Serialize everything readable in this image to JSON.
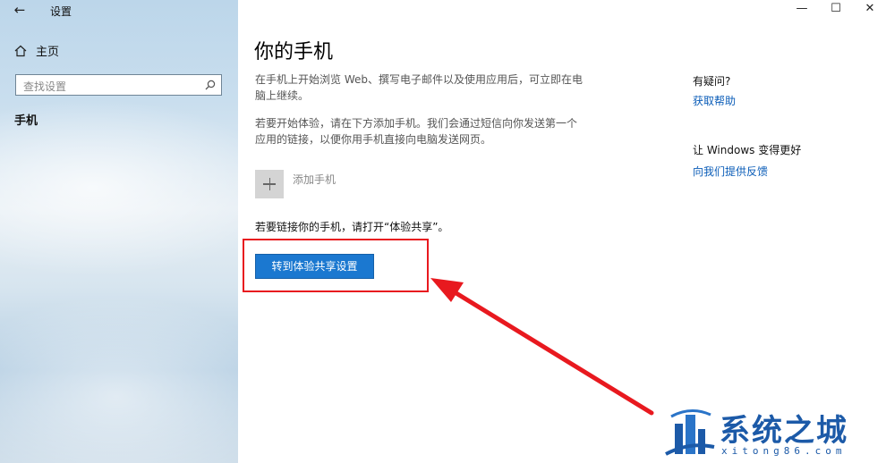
{
  "window": {
    "title": "设置",
    "back_glyph": "←",
    "minimize_glyph": "—",
    "maximize_glyph": "☐",
    "close_glyph": "✕"
  },
  "sidebar": {
    "home_label": "主页",
    "search_placeholder": "查找设置",
    "items": [
      {
        "label": "手机",
        "selected": true
      }
    ]
  },
  "main": {
    "title": "你的手机",
    "intro": "在手机上开始浏览 Web、撰写电子邮件以及使用应用后，可立即在电脑上继续。",
    "instruction": "若要开始体验，请在下方添加手机。我们会通过短信向你发送第一个应用的链接，以便你用手机直接向电脑发送网页。",
    "add_phone_label": "添加手机",
    "link_note": "若要链接你的手机，请打开“体验共享”。",
    "primary_button_label": "转到体验共享设置"
  },
  "help": {
    "question_heading": "有疑问?",
    "help_link": "获取帮助",
    "improve_heading": "让 Windows 变得更好",
    "feedback_link": "向我们提供反馈"
  },
  "watermark": {
    "brand": "系统之城",
    "domain": "xitong86.com"
  },
  "colors": {
    "accent": "#1b78d0",
    "link": "#0b5db8",
    "annotation": "#e8191f",
    "brand": "#1c5aa8"
  }
}
